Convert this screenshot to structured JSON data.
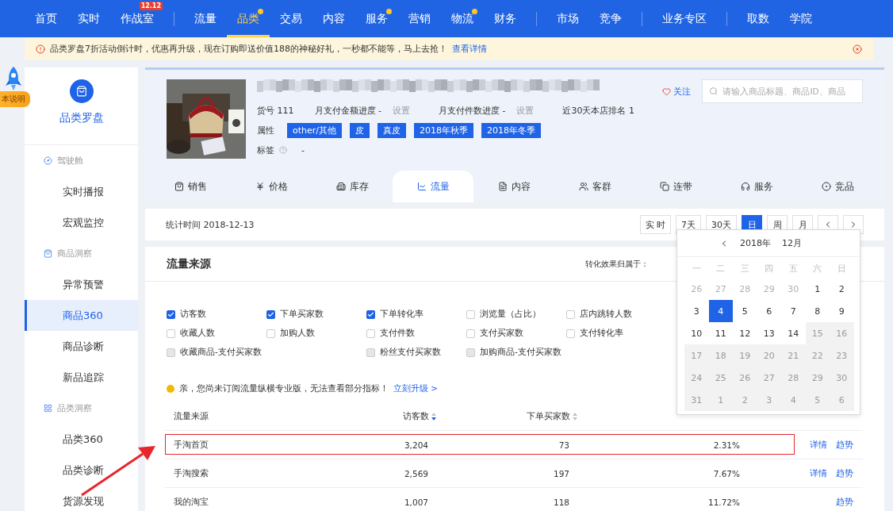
{
  "top_nav": {
    "groups": [
      {
        "items": [
          {
            "label": "首页",
            "selected": false,
            "dot": false
          },
          {
            "label": "实时",
            "selected": false,
            "dot": false
          },
          {
            "label": "作战室",
            "selected": false,
            "dot": false,
            "badge": "12.12"
          }
        ]
      },
      {
        "items": [
          {
            "label": "流量",
            "selected": false,
            "dot": false
          },
          {
            "label": "品类",
            "selected": true,
            "dot": true
          },
          {
            "label": "交易",
            "selected": false,
            "dot": false
          },
          {
            "label": "内容",
            "selected": false,
            "dot": false
          },
          {
            "label": "服务",
            "selected": false,
            "dot": true
          },
          {
            "label": "营销",
            "selected": false,
            "dot": false
          },
          {
            "label": "物流",
            "selected": false,
            "dot": true
          },
          {
            "label": "财务",
            "selected": false,
            "dot": false
          }
        ]
      },
      {
        "items": [
          {
            "label": "市场",
            "selected": false,
            "dot": false
          },
          {
            "label": "竞争",
            "selected": false,
            "dot": false
          }
        ]
      },
      {
        "items": [
          {
            "label": "业务专区",
            "selected": false,
            "dot": false
          }
        ]
      },
      {
        "items": [
          {
            "label": "取数",
            "selected": false,
            "dot": false
          },
          {
            "label": "学院",
            "selected": false,
            "dot": false
          }
        ]
      }
    ]
  },
  "notice": {
    "text": "品类罗盘7折活动倒计时，优惠再升级，现在订购即送价值188的神秘好礼，一秒都不能等，马上去抢！",
    "link": "查看详情"
  },
  "version_badge": "本说明",
  "sidebar": {
    "title": "品类罗盘",
    "groups": [
      {
        "label": "驾驶舱",
        "children": [
          {
            "label": "实时播报",
            "selected": false
          },
          {
            "label": "宏观监控",
            "selected": false
          }
        ]
      },
      {
        "label": "商品洞察",
        "children": [
          {
            "label": "异常预警",
            "selected": false
          },
          {
            "label": "商品360",
            "selected": true
          },
          {
            "label": "商品诊断",
            "selected": false
          },
          {
            "label": "新品追踪",
            "selected": false
          }
        ]
      },
      {
        "label": "品类洞察",
        "children": [
          {
            "label": "品类360",
            "selected": false
          },
          {
            "label": "品类诊断",
            "selected": false
          },
          {
            "label": "货源发现",
            "selected": false
          }
        ]
      }
    ]
  },
  "product": {
    "image": {
      "kind": "picture"
    },
    "meta": [
      {
        "label": "货号 111"
      },
      {
        "label": "月支付金额进度 -",
        "action": "设置"
      },
      {
        "label": "月支付件数进度 -",
        "action": "设置"
      },
      {
        "label": "近30天本店排名 1"
      }
    ],
    "attributes_label": "属性",
    "attributes": [
      "other/其他",
      "皮",
      "真皮",
      "2018年秋季",
      "2018年冬季"
    ],
    "tags_label": "标签",
    "tags_value": "-",
    "follow": "关注",
    "search": {
      "placeholder": "请输入商品标题、商品ID、商品"
    }
  },
  "tabs": [
    {
      "label": "销售",
      "selected": false
    },
    {
      "label": "价格",
      "selected": false
    },
    {
      "label": "库存",
      "selected": false
    },
    {
      "label": "流量",
      "selected": true
    },
    {
      "label": "内容",
      "selected": false
    },
    {
      "label": "客群",
      "selected": false
    },
    {
      "label": "连带",
      "selected": false
    },
    {
      "label": "服务",
      "selected": false
    },
    {
      "label": "竞品",
      "selected": false
    }
  ],
  "stats_time": "统计时间 2018-12-13",
  "range_buttons": [
    {
      "label": "实 时",
      "selected": false
    },
    {
      "label": "7天",
      "selected": false
    },
    {
      "label": "30天",
      "selected": false
    },
    {
      "label": "日",
      "selected": true
    },
    {
      "label": "周",
      "selected": false
    },
    {
      "label": "月",
      "selected": false
    }
  ],
  "traffic": {
    "title": "流量来源",
    "attribution_label": "转化效果归属于：",
    "metrics": [
      [
        {
          "label": "访客数",
          "checked": true,
          "disabled": false
        },
        {
          "label": "下单买家数",
          "checked": true,
          "disabled": false
        },
        {
          "label": "下单转化率",
          "checked": true,
          "disabled": false
        },
        {
          "label": "浏览量（占比）",
          "checked": false,
          "disabled": false
        },
        {
          "label": "店内跳转人数",
          "checked": false,
          "disabled": false
        }
      ],
      [
        {
          "label": "收藏人数",
          "checked": false,
          "disabled": false
        },
        {
          "label": "加购人数",
          "checked": false,
          "disabled": false
        },
        {
          "label": "支付件数",
          "checked": false,
          "disabled": false
        },
        {
          "label": "支付买家数",
          "checked": false,
          "disabled": false
        },
        {
          "label": "支付转化率",
          "checked": false,
          "disabled": false
        }
      ],
      [
        {
          "label": "收藏商品-支付买家数",
          "checked": false,
          "disabled": true
        },
        {
          "label": "粉丝支付买家数",
          "checked": false,
          "disabled": true
        },
        {
          "label": "加购商品-支付买家数",
          "checked": false,
          "disabled": true
        }
      ]
    ],
    "upgrade_text": "亲，您尚未订阅流量纵横专业版，无法查看部分指标！",
    "upgrade_link": "立刻升级 >",
    "columns": [
      "流量来源",
      "访客数",
      "下单买家数"
    ],
    "rows": [
      {
        "source": "手淘首页",
        "visitors": "3,204",
        "buyers": "73",
        "rate": "2.31%",
        "actions": [
          "详情",
          "趋势"
        ],
        "highlighted": true
      },
      {
        "source": "手淘搜索",
        "visitors": "2,569",
        "buyers": "197",
        "rate": "7.67%",
        "actions": [
          "详情",
          "趋势"
        ],
        "highlighted": false
      },
      {
        "source": "我的淘宝",
        "visitors": "1,007",
        "buyers": "118",
        "rate": "11.72%",
        "actions": [
          "趋势"
        ],
        "highlighted": false
      }
    ]
  },
  "calendar": {
    "year": "2018年",
    "month": "12月",
    "weekdays": [
      "一",
      "二",
      "三",
      "四",
      "五",
      "六",
      "日"
    ],
    "days": [
      {
        "day": "26",
        "kind": "outside",
        "selected": false
      },
      {
        "day": "27",
        "kind": "outside",
        "selected": false
      },
      {
        "day": "28",
        "kind": "outside",
        "selected": false
      },
      {
        "day": "29",
        "kind": "outside",
        "selected": false
      },
      {
        "day": "30",
        "kind": "outside",
        "selected": false
      },
      {
        "day": "1",
        "kind": "normal",
        "selected": false
      },
      {
        "day": "2",
        "kind": "normal",
        "selected": false
      },
      {
        "day": "3",
        "kind": "normal",
        "selected": false
      },
      {
        "day": "4",
        "kind": "normal",
        "selected": true
      },
      {
        "day": "5",
        "kind": "normal",
        "selected": false
      },
      {
        "day": "6",
        "kind": "normal",
        "selected": false
      },
      {
        "day": "7",
        "kind": "normal",
        "selected": false
      },
      {
        "day": "8",
        "kind": "normal",
        "selected": false
      },
      {
        "day": "9",
        "kind": "normal",
        "selected": false
      },
      {
        "day": "10",
        "kind": "normal",
        "selected": false
      },
      {
        "day": "11",
        "kind": "normal",
        "selected": false
      },
      {
        "day": "12",
        "kind": "normal",
        "selected": false
      },
      {
        "day": "13",
        "kind": "normal",
        "selected": false
      },
      {
        "day": "14",
        "kind": "normal",
        "selected": false
      },
      {
        "day": "15",
        "kind": "disabled",
        "selected": false
      },
      {
        "day": "16",
        "kind": "disabled",
        "selected": false
      },
      {
        "day": "17",
        "kind": "disabled",
        "selected": false
      },
      {
        "day": "18",
        "kind": "disabled",
        "selected": false
      },
      {
        "day": "19",
        "kind": "disabled",
        "selected": false
      },
      {
        "day": "20",
        "kind": "disabled",
        "selected": false
      },
      {
        "day": "21",
        "kind": "disabled",
        "selected": false
      },
      {
        "day": "22",
        "kind": "disabled",
        "selected": false
      },
      {
        "day": "23",
        "kind": "disabled",
        "selected": false
      },
      {
        "day": "24",
        "kind": "disabled",
        "selected": false
      },
      {
        "day": "25",
        "kind": "disabled",
        "selected": false
      },
      {
        "day": "26",
        "kind": "disabled",
        "selected": false
      },
      {
        "day": "27",
        "kind": "disabled",
        "selected": false
      },
      {
        "day": "28",
        "kind": "disabled",
        "selected": false
      },
      {
        "day": "29",
        "kind": "disabled",
        "selected": false
      },
      {
        "day": "30",
        "kind": "disabled",
        "selected": false
      },
      {
        "day": "31",
        "kind": "disabled",
        "selected": false
      },
      {
        "day": "1",
        "kind": "disabled",
        "selected": false
      },
      {
        "day": "2",
        "kind": "disabled",
        "selected": false
      },
      {
        "day": "3",
        "kind": "disabled",
        "selected": false
      },
      {
        "day": "4",
        "kind": "disabled",
        "selected": false
      },
      {
        "day": "5",
        "kind": "disabled",
        "selected": false
      },
      {
        "day": "6",
        "kind": "disabled",
        "selected": false
      }
    ]
  }
}
